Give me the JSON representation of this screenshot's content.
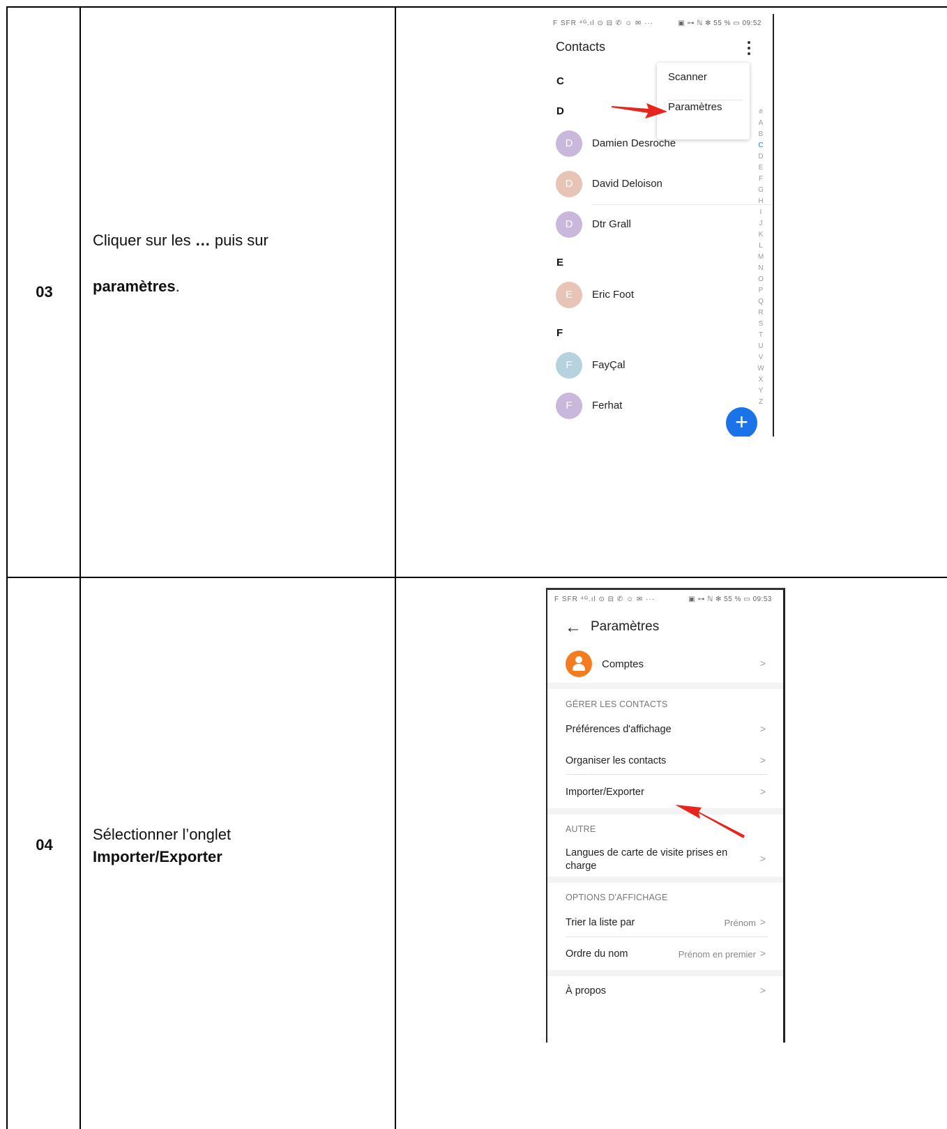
{
  "steps": [
    {
      "number": "03",
      "text_line1": "Cliquer sur les ",
      "text_bold1": "…",
      "text_line1_end": " puis sur",
      "text_bold2": "paramètres",
      "text_end": "."
    },
    {
      "number": "04",
      "text_line1": "Sélectionner l’onglet",
      "text_bold": "Importer/Exporter"
    }
  ],
  "phone1": {
    "status_left": "F SFR ⁴ᴳ.ıl ⊙ ⊟ ✆ ☺ ✉ ···",
    "status_right": "▣ ⊶ ℕ ✻ 55 % ▭ 09:52",
    "title": "Contacts",
    "menu": [
      "Scanner",
      "Paramètres"
    ],
    "sections": [
      {
        "letter": "C"
      },
      {
        "letter": "D"
      },
      {
        "letter": "E"
      },
      {
        "letter": "F"
      }
    ],
    "contacts": [
      {
        "initial": "D",
        "name": "Damien Desroche",
        "color": "#c9b8dc"
      },
      {
        "initial": "D",
        "name": "David Deloison",
        "color": "#e8c4b6"
      },
      {
        "initial": "D",
        "name": "Dtr Grall",
        "color": "#c9b8dc"
      },
      {
        "initial": "E",
        "name": "Eric Foot",
        "color": "#e8c4b6"
      },
      {
        "initial": "F",
        "name": "FayÇal",
        "color": "#b7d2df"
      },
      {
        "initial": "F",
        "name": "Ferhat",
        "color": "#c9b8dc"
      }
    ],
    "alphabet": [
      "#",
      "A",
      "B",
      "C",
      "D",
      "E",
      "F",
      "G",
      "H",
      "I",
      "J",
      "K",
      "L",
      "M",
      "N",
      "O",
      "P",
      "Q",
      "R",
      "S",
      "T",
      "U",
      "V",
      "W",
      "X",
      "Y",
      "Z"
    ],
    "alphabet_active": "C",
    "fab_label": "+"
  },
  "phone2": {
    "status_left": "F SFR ⁴ᴳ.ıl ⊙ ⊟ ✆ ☺ ✉ ···",
    "status_right": "▣ ⊶ ℕ ✻ 55 % ▭ 09:53",
    "back_icon": "←",
    "title": "Paramètres",
    "comptes": "Comptes",
    "head_gerer": "GÉRER LES CONTACTS",
    "pref": "Préférences d'affichage",
    "organiser": "Organiser les contacts",
    "importer": "Importer/Exporter",
    "head_autre": "AUTRE",
    "langues_1": "Langues de carte de visite prises en",
    "langues_2": "charge",
    "head_options": "OPTIONS D'AFFICHAGE",
    "trier": "Trier la liste par",
    "trier_value": "Prénom",
    "ordre": "Ordre du nom",
    "ordre_value": "Prénom en premier",
    "apropos": "À propos",
    "chevron": ">"
  },
  "colors": {
    "accent_blue": "#1a73e8",
    "arrow_red": "#e8251c",
    "account_orange": "#f47c20"
  }
}
